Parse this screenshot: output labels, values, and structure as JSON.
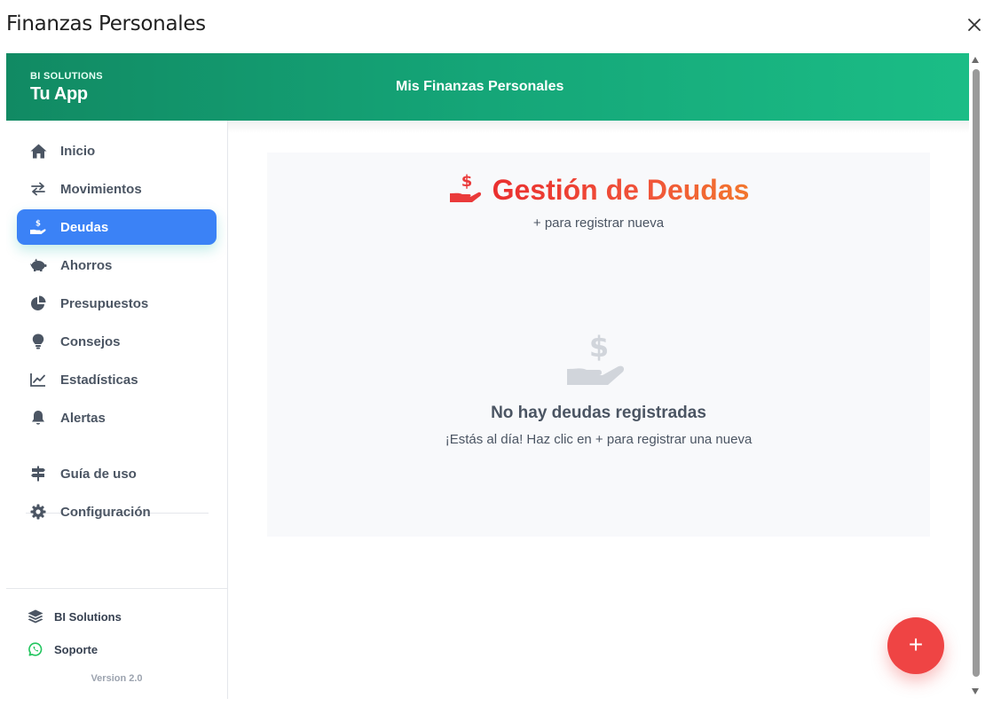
{
  "window": {
    "title": "Finanzas Personales",
    "close_icon": "close-icon"
  },
  "header": {
    "brand_top": "BI SOLUTIONS",
    "brand_main": "Tu App",
    "title": "Mis Finanzas Personales"
  },
  "sidebar": {
    "items": [
      {
        "label": "Inicio",
        "icon": "home-icon",
        "active": false
      },
      {
        "label": "Movimientos",
        "icon": "exchange-arrows-icon",
        "active": false
      },
      {
        "label": "Deudas",
        "icon": "hand-dollar-icon",
        "active": true
      },
      {
        "label": "Ahorros",
        "icon": "piggy-bank-icon",
        "active": false
      },
      {
        "label": "Presupuestos",
        "icon": "pie-chart-icon",
        "active": false
      },
      {
        "label": "Consejos",
        "icon": "lightbulb-icon",
        "active": false
      },
      {
        "label": "Estadísticas",
        "icon": "line-chart-icon",
        "active": false
      },
      {
        "label": "Alertas",
        "icon": "bell-icon",
        "active": false
      },
      {
        "label": "Guía de uso",
        "icon": "signpost-icon",
        "active": false
      },
      {
        "label": "Configuración",
        "icon": "gear-icon",
        "active": false
      }
    ],
    "footer": {
      "company": "BI Solutions",
      "support": "Soporte",
      "version": "Version 2.0"
    }
  },
  "main": {
    "title": "Gestión de Deudas",
    "subtitle": "+ para registrar nueva",
    "empty_title": "No hay deudas registradas",
    "empty_subtitle": "¡Estás al día! Haz clic en + para registrar una nueva",
    "fab_label": "+"
  },
  "colors": {
    "header_gradient_start": "#118a63",
    "header_gradient_end": "#1bbd86",
    "active_item": "#3b82f6",
    "title_gradient_start": "#ea2f2f",
    "title_gradient_end": "#f2762c",
    "fab": "#ef4444",
    "whatsapp": "#22c55e"
  }
}
